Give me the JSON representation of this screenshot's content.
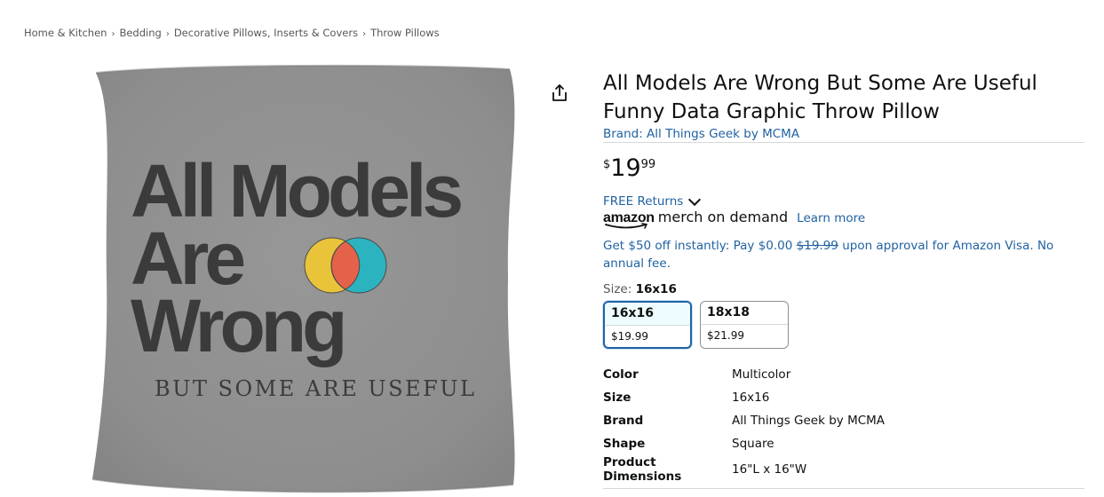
{
  "breadcrumb": [
    "Home & Kitchen",
    "Bedding",
    "Decorative Pillows, Inserts & Covers",
    "Throw Pillows"
  ],
  "breadcrumb_separator": "›",
  "product_image": {
    "line1": "All Models",
    "line2": "Are",
    "line3": "Wrong",
    "subline": "BUT SOME ARE USEFUL",
    "pillow_color": "#8f8f8f",
    "text_color": "#3b3b3b",
    "circle_left_color": "#e9c43b",
    "circle_right_color": "#2bb3c0",
    "overlap_color": "#e5624a"
  },
  "title": "All Models Are Wrong But Some Are Useful Funny Data Graphic Throw Pillow",
  "brand_link": "Brand: All Things Geek by MCMA",
  "price": {
    "symbol": "$",
    "whole": "19",
    "fraction": "99"
  },
  "free_returns": "FREE Returns",
  "merch": {
    "amazon_word": "amazon",
    "merch_word": "merch on demand",
    "learn_more": "Learn more"
  },
  "promo": {
    "prefix": "Get $50 off instantly: Pay $0.00",
    "strike_price": "$19.99",
    "suffix": "upon approval for Amazon Visa. No annual fee."
  },
  "size": {
    "label": "Size:",
    "selected": "16x16",
    "options": [
      {
        "name": "16x16",
        "price": "$19.99"
      },
      {
        "name": "18x18",
        "price": "$21.99"
      }
    ]
  },
  "specs": [
    {
      "key": "Color",
      "value": "Multicolor"
    },
    {
      "key": "Size",
      "value": "16x16"
    },
    {
      "key": "Brand",
      "value": "All Things Geek by MCMA"
    },
    {
      "key": "Shape",
      "value": "Square"
    },
    {
      "key": "Product Dimensions",
      "value": "16\"L x 16\"W"
    }
  ],
  "colors": {
    "link": "#2162a1",
    "text": "#0f1111",
    "muted": "#565959",
    "selected_border": "#2162a1"
  },
  "icons": {
    "share": "share-icon",
    "chevron": "chevron-down-icon"
  }
}
